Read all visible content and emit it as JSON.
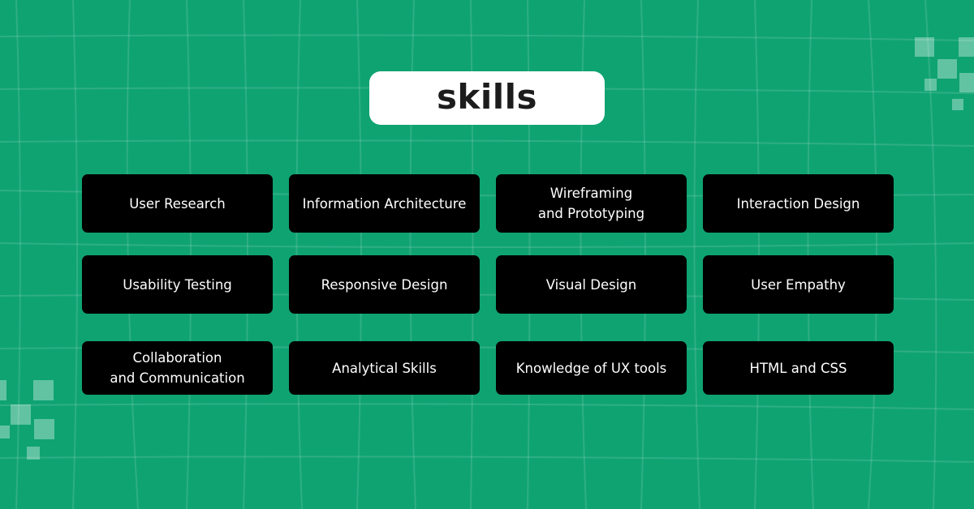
{
  "title": "skills",
  "colors": {
    "background": "#0fa372",
    "card": "#000000",
    "card_text": "#ffffff",
    "title_box": "#ffffff",
    "title_text": "#1c1c1c"
  },
  "skills": [
    {
      "label": "User Research"
    },
    {
      "label": "Information Architecture"
    },
    {
      "label": "Wireframing\nand Prototyping"
    },
    {
      "label": "Interaction Design"
    },
    {
      "label": "Usability Testing"
    },
    {
      "label": "Responsive Design"
    },
    {
      "label": "Visual Design"
    },
    {
      "label": "User Empathy"
    },
    {
      "label": "Collaboration\nand Communication"
    },
    {
      "label": "Analytical Skills"
    },
    {
      "label": "Knowledge of UX tools"
    },
    {
      "label": "HTML and CSS"
    }
  ]
}
